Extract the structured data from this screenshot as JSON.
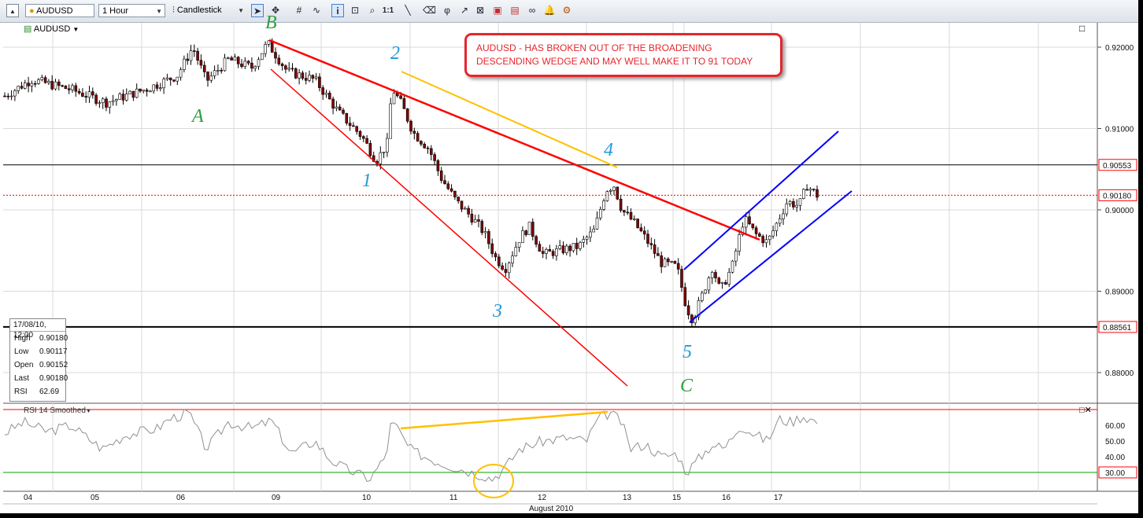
{
  "toolbar": {
    "symbol": "AUDUSD",
    "interval": "1 Hour",
    "chart_style": "Candlestick",
    "zoom_label": "1:1"
  },
  "chart_symbol_label": "AUDUSD",
  "annotation": {
    "line1": "AUDUSD - HAS BROKEN OUT OF THE BROADENING",
    "line2": "DESCENDING WEDGE AND MAY WELL MAKE IT TO 91 TODAY"
  },
  "info_box": {
    "header": "17/08/10, 12:00",
    "rows": [
      {
        "label": "High",
        "value": "0.90180"
      },
      {
        "label": "Low",
        "value": "0.90117"
      },
      {
        "label": "Open",
        "value": "0.90152"
      },
      {
        "label": "Last",
        "value": "0.90180"
      },
      {
        "label": "RSI",
        "value": "62.69"
      }
    ]
  },
  "colors": {
    "up_candle": "#ffffff",
    "down_candle": "#800000",
    "wedge": "#ff0000",
    "channel": "#0000ff",
    "divergence": "#ffc000",
    "wave_blue": "#1f9ad6",
    "wave_green": "#2ea043",
    "rsi_line": "#909090",
    "rsi_30": "#00a000",
    "rsi_70": "#ff0000"
  },
  "chart_data": [
    {
      "type": "candlestick",
      "symbol": "AUDUSD",
      "interval": "1 Hour",
      "y_ticks": [
        0.92,
        0.91,
        0.9,
        0.89,
        0.88
      ],
      "y_tick_labels": [
        "0.92000",
        "0.91000",
        "0.90000",
        "0.89000",
        "0.88000"
      ],
      "ylim": [
        0.8745,
        0.9225
      ],
      "price_tags": [
        {
          "value": 0.90553,
          "label": "0.90553",
          "style": "solid-black"
        },
        {
          "value": 0.9018,
          "label": "0.90180",
          "style": "dotted-red"
        },
        {
          "value": 0.88561,
          "label": "0.88561",
          "style": "solid-black"
        }
      ],
      "x_tick_labels": [
        "04",
        "05",
        "06",
        "09",
        "10",
        "11",
        "12",
        "13",
        "15",
        "16",
        "17"
      ],
      "x_month_label": "August 2010",
      "ohlc_sample": [
        {
          "label": "A",
          "approx_close": 0.914
        },
        {
          "label": "B",
          "approx_close": 0.9205
        },
        {
          "label": "1",
          "approx_close": 0.9055
        },
        {
          "label": "2",
          "approx_close": 0.916
        },
        {
          "label": "3",
          "approx_close": 0.892
        },
        {
          "label": "4",
          "approx_close": 0.903
        },
        {
          "label": "5",
          "approx_close": 0.886
        },
        {
          "label": "last",
          "approx_close": 0.9018
        }
      ],
      "wave_labels_blue": [
        "1",
        "2",
        "3",
        "4",
        "5"
      ],
      "wave_labels_green": [
        "A",
        "B",
        "C"
      ]
    },
    {
      "type": "line",
      "name": "RSI 14 Smoothed",
      "y_ticks": [
        60,
        50,
        40,
        30
      ],
      "y_tick_labels": [
        "60.00",
        "50.00",
        "40.00",
        "30.00"
      ],
      "levels": [
        30,
        70
      ],
      "ylim": [
        12,
        75
      ]
    }
  ]
}
